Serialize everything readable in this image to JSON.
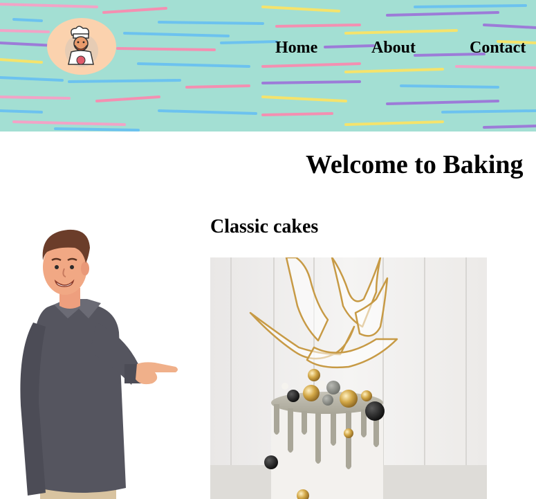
{
  "header": {
    "logo_icon": "chef-mascot-icon",
    "nav": {
      "home": "Home",
      "about": "About",
      "contact": "Contact"
    }
  },
  "main": {
    "heading": "Welcome to Baking",
    "illustration_icon": "pointing-man-illustration",
    "section": {
      "title": "Classic cakes",
      "image_icon": "drip-cake-photo"
    }
  },
  "colors": {
    "header_bg": "#a3dfd3",
    "logo_bg": "#fbd2ae",
    "sweater": "#55555f",
    "cake": "#f3f1ee"
  }
}
